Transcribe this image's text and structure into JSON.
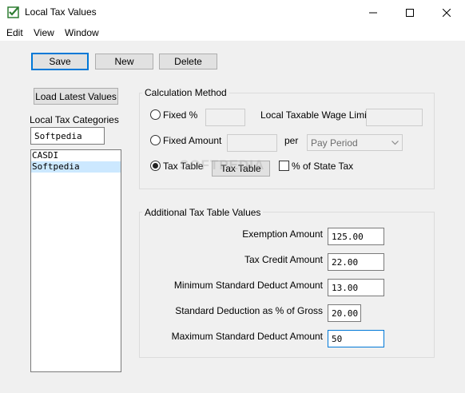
{
  "window": {
    "title": "Local Tax Values",
    "min_glyph": "─",
    "max_glyph": "☐",
    "close_glyph": "✕"
  },
  "menu": [
    "Edit",
    "View",
    "Window"
  ],
  "toolbar": {
    "save_label": "Save",
    "new_label": "New",
    "delete_label": "Delete"
  },
  "left_panel": {
    "load_button": "Load Latest Values",
    "categories_label": "Local Tax Categories",
    "category_value": "Softpedia",
    "items": [
      {
        "label": "CASDI",
        "selected": false
      },
      {
        "label": "Softpedia",
        "selected": true
      }
    ]
  },
  "calc_method": {
    "title": "Calculation Method",
    "fixed_pct_label": "Fixed %",
    "fixed_pct_value": "",
    "wage_limit_label": "Local Taxable Wage Limit",
    "wage_limit_value": "",
    "fixed_amount_label": "Fixed Amount",
    "fixed_amount_value": "",
    "per_label": "per",
    "per_select": "Pay Period",
    "tax_table_label": "Tax Table",
    "tax_table_button": "Tax Table",
    "pct_state_label": "% of State Tax",
    "selected_method": "Tax Table",
    "pct_state_checked": false
  },
  "additional": {
    "title": "Additional Tax Table Values",
    "rows": [
      {
        "label": "Exemption Amount",
        "value": "125.00"
      },
      {
        "label": "Tax Credit Amount",
        "value": "22.00"
      },
      {
        "label": "Minimum Standard Deduct Amount",
        "value": "13.00"
      },
      {
        "label": "Standard Deduction as % of Gross",
        "value": "20.00"
      },
      {
        "label": "Maximum Standard Deduct Amount",
        "value": "50"
      }
    ]
  },
  "watermark": "SOFTPEDIA",
  "colors": {
    "client_bg": "#f0f0f0",
    "selection": "#cce8ff",
    "focus": "#0078d7"
  }
}
